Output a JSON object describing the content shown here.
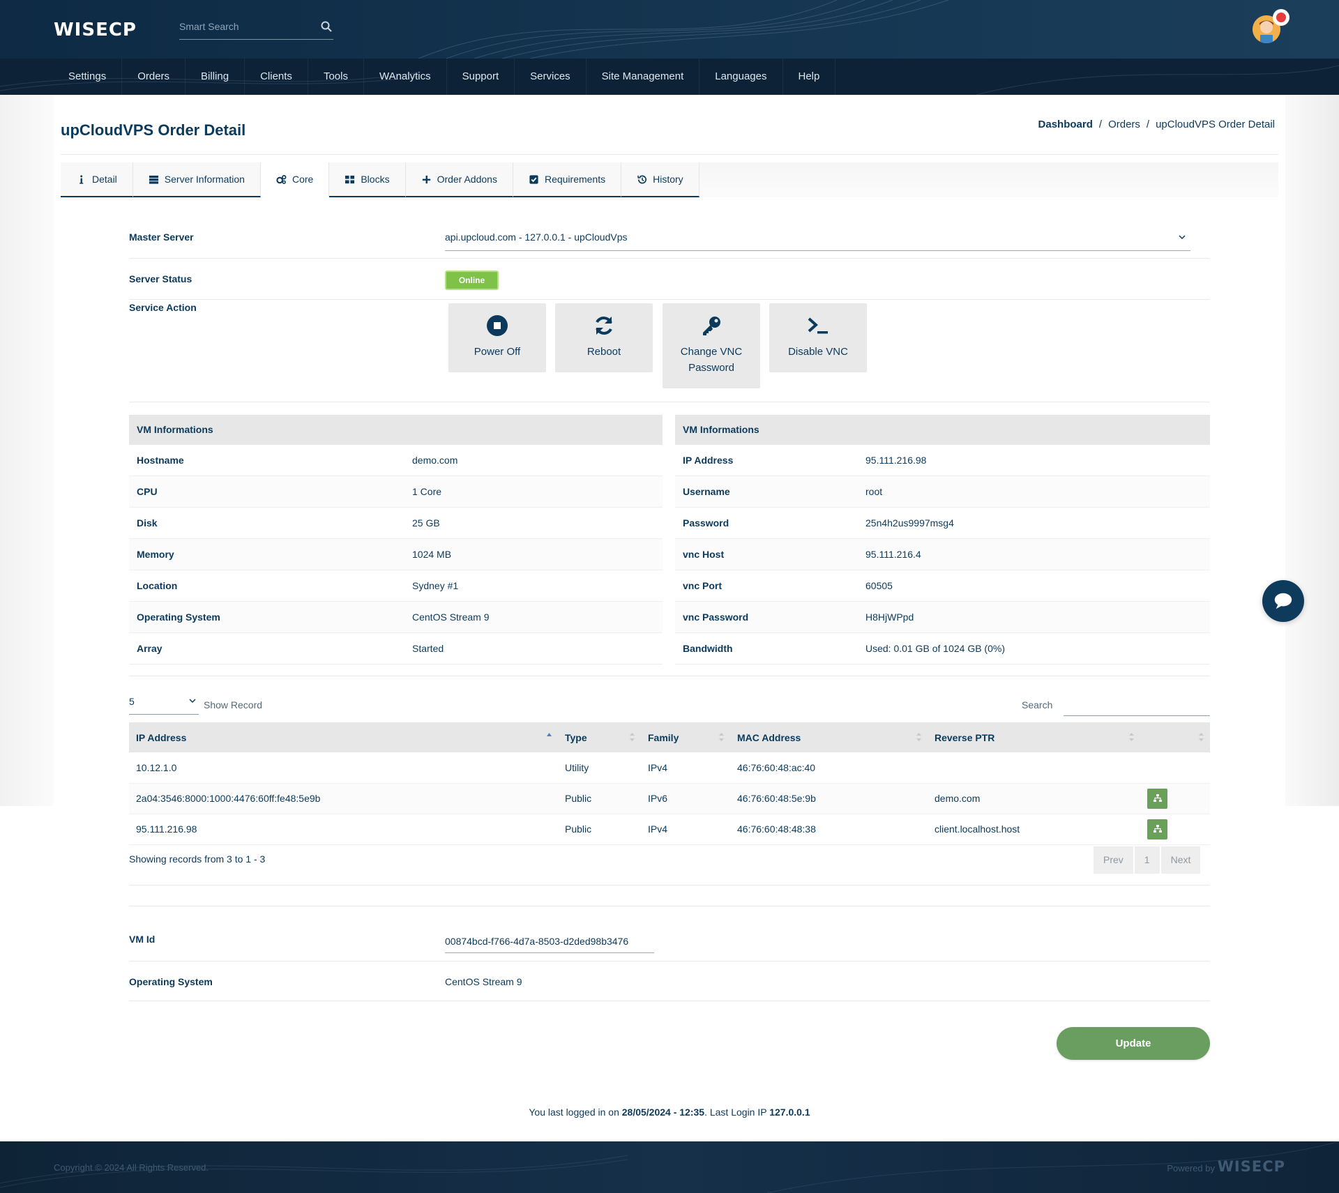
{
  "header": {
    "logo": "WISECP",
    "search_placeholder": "Smart Search"
  },
  "nav": {
    "items": [
      "Settings",
      "Orders",
      "Billing",
      "Clients",
      "Tools",
      "WAnalytics",
      "Support",
      "Services",
      "Site Management",
      "Languages",
      "Help"
    ]
  },
  "page": {
    "title": "upCloudVPS Order Detail",
    "breadcrumb": [
      "Dashboard",
      "Orders",
      "upCloudVPS Order Detail"
    ],
    "breadcrumb_sep": "/"
  },
  "tabs": [
    {
      "label": "Detail",
      "icon": "info-icon"
    },
    {
      "label": "Server Information",
      "icon": "server-icon"
    },
    {
      "label": "Core",
      "icon": "cogs-icon"
    },
    {
      "label": "Blocks",
      "icon": "blocks-icon"
    },
    {
      "label": "Order Addons",
      "icon": "plus-icon"
    },
    {
      "label": "Requirements",
      "icon": "checkbox-icon"
    },
    {
      "label": "History",
      "icon": "history-icon"
    }
  ],
  "form": {
    "master_server_label": "Master Server",
    "master_server_value": "api.upcloud.com - 127.0.0.1 - upCloudVps",
    "server_status_label": "Server Status",
    "server_status_value": "Online",
    "service_action_label": "Service Action",
    "actions": [
      {
        "label": "Power Off",
        "icon": "stop-icon"
      },
      {
        "label": "Reboot",
        "icon": "refresh-icon"
      },
      {
        "label": "Change VNC Password",
        "icon": "key-icon"
      },
      {
        "label": "Disable VNC",
        "icon": "terminal-icon"
      }
    ]
  },
  "vm_left": {
    "title": "VM Informations",
    "rows": [
      {
        "k": "Hostname",
        "v": "demo.com"
      },
      {
        "k": "CPU",
        "v": "1 Core"
      },
      {
        "k": "Disk",
        "v": "25 GB"
      },
      {
        "k": "Memory",
        "v": "1024 MB"
      },
      {
        "k": "Location",
        "v": "Sydney #1"
      },
      {
        "k": "Operating System",
        "v": "CentOS Stream 9"
      },
      {
        "k": "Array",
        "v": "Started"
      }
    ]
  },
  "vm_right": {
    "title": "VM Informations",
    "rows": [
      {
        "k": "IP Address",
        "v": "95.111.216.98"
      },
      {
        "k": "Username",
        "v": "root"
      },
      {
        "k": "Password",
        "v": "25n4h2us9997msg4"
      },
      {
        "k": "vnc Host",
        "v": "95.111.216.4"
      },
      {
        "k": "vnc Port",
        "v": "60505"
      },
      {
        "k": "vnc Password",
        "v": "H8HjWPpd"
      },
      {
        "k": "Bandwidth",
        "v": "Used: 0.01 GB of 1024 GB (0%)"
      }
    ]
  },
  "records": {
    "page_size": "5",
    "show_record": "Show Record",
    "search_label": "Search",
    "columns": [
      "IP Address",
      "Type",
      "Family",
      "MAC Address",
      "Reverse PTR"
    ],
    "rows": [
      {
        "ip": "10.12.1.0",
        "type": "Utility",
        "family": "IPv4",
        "mac": "46:76:60:48:ac:40",
        "ptr": "",
        "has_action": false
      },
      {
        "ip": "2a04:3546:8000:1000:4476:60ff:fe48:5e9b",
        "type": "Public",
        "family": "IPv6",
        "mac": "46:76:60:48:5e:9b",
        "ptr": "demo.com",
        "has_action": true
      },
      {
        "ip": "95.111.216.98",
        "type": "Public",
        "family": "IPv4",
        "mac": "46:76:60:48:48:38",
        "ptr": "client.localhost.host",
        "has_action": true
      }
    ],
    "showing": "Showing records from 3 to 1 - 3",
    "pager": [
      "Prev",
      "1",
      "Next"
    ]
  },
  "vm": {
    "id_label": "VM Id",
    "id_value": "00874bcd-f766-4d7a-8503-d2ded98b3476",
    "os_label": "Operating System",
    "os_value": "CentOS Stream 9"
  },
  "update_label": "Update",
  "last_login": {
    "prefix": "You last logged in on ",
    "date": "28/05/2024 - 12:35",
    "middle": ". Last Login IP ",
    "ip": "127.0.0.1"
  },
  "footer": {
    "copyright": "Copyright © 2024 All Rights Reserved.",
    "powered": "Powered by",
    "logo": "WISECP"
  },
  "colors": {
    "primary": "#0b3a5c",
    "header_bg": "#14344f",
    "nav_bg": "#0d2237",
    "online": "#7fc24a",
    "update": "#6a9e61"
  }
}
